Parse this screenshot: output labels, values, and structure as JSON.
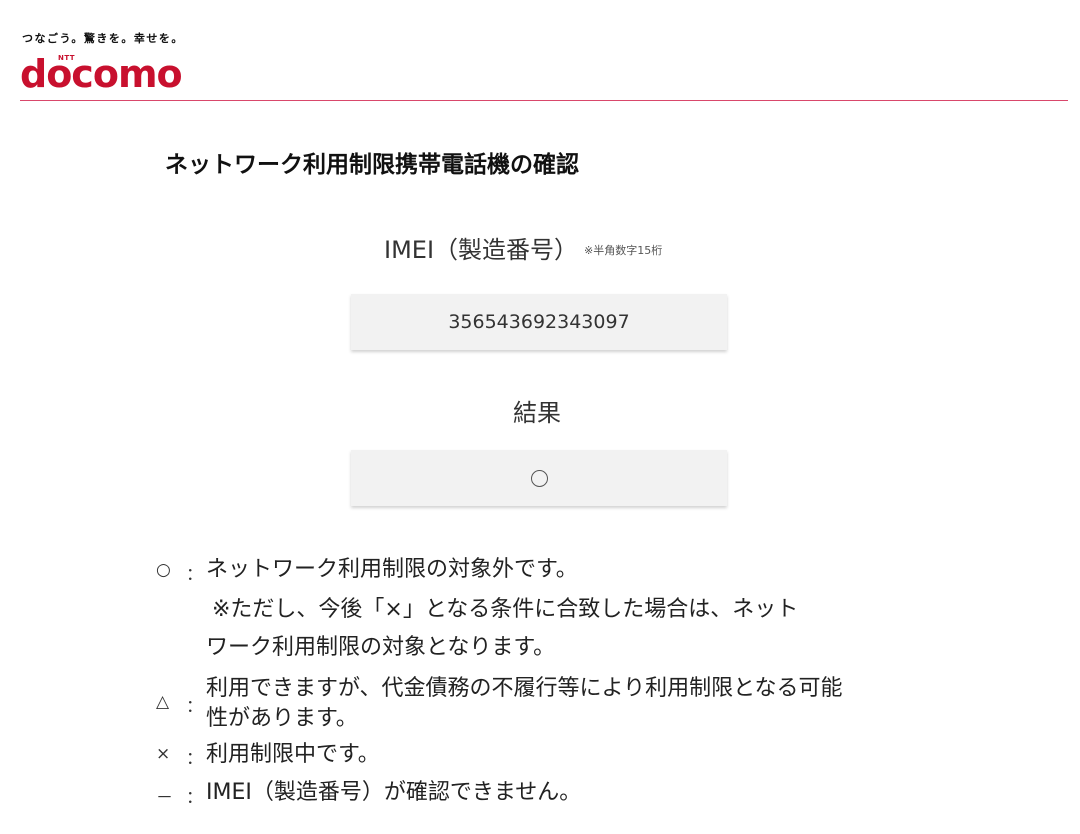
{
  "brand": {
    "tagline": "つなごう。驚きを。幸せを。",
    "logo_small": "NTT",
    "logo_word": "docomo",
    "accent_color": "#c8102e"
  },
  "page": {
    "title": "ネットワーク利用制限携帯電話機の確認"
  },
  "imei": {
    "label": "IMEI（製造番号）",
    "note": "※半角数字15桁",
    "value": "356543692343097"
  },
  "result": {
    "label": "結果",
    "value_icon": "circle"
  },
  "legend": [
    {
      "symbol": "○",
      "separator": "：",
      "lines": [
        "ネットワーク利用制限の対象外です。",
        "※ただし、今後「×」となる条件に合致した場合は、ネット",
        "ワーク利用制限の対象となります。"
      ]
    },
    {
      "symbol": "△",
      "separator": "：",
      "lines": [
        "利用できますが、代金債務の不履行等により利用制限となる可能",
        "性があります。"
      ]
    },
    {
      "symbol": "×",
      "separator": "：",
      "lines": [
        "利用制限中です。"
      ]
    },
    {
      "symbol": "－",
      "separator": "：",
      "lines": [
        "IMEI（製造番号）が確認できません。"
      ]
    }
  ]
}
